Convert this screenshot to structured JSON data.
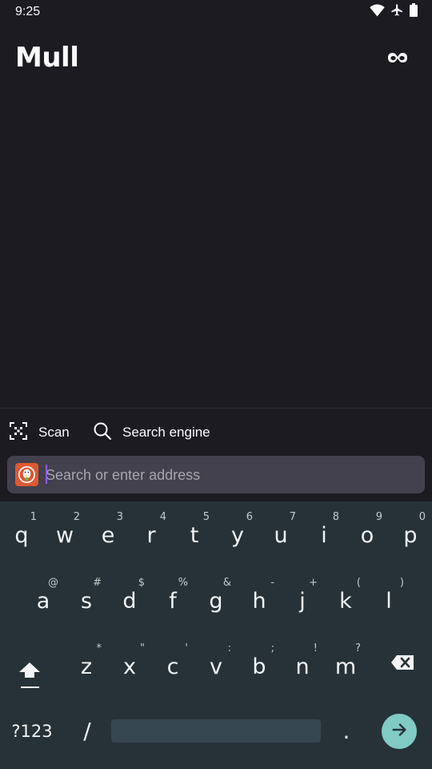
{
  "status_bar": {
    "time": "9:25",
    "icons": [
      "wifi-icon",
      "airplane-mode-icon",
      "battery-icon"
    ]
  },
  "header": {
    "app_title": "Mull",
    "private_mode_icon": "mask-icon"
  },
  "toolbar": {
    "scan_label": "Scan",
    "search_engine_label": "Search engine"
  },
  "url_bar": {
    "placeholder": "Search or enter address",
    "value": "",
    "engine_icon": "duckduckgo-icon"
  },
  "keyboard": {
    "row1": [
      {
        "key": "q",
        "hint": "1"
      },
      {
        "key": "w",
        "hint": "2"
      },
      {
        "key": "e",
        "hint": "3"
      },
      {
        "key": "r",
        "hint": "4"
      },
      {
        "key": "t",
        "hint": "5"
      },
      {
        "key": "y",
        "hint": "6"
      },
      {
        "key": "u",
        "hint": "7"
      },
      {
        "key": "i",
        "hint": "8"
      },
      {
        "key": "o",
        "hint": "9"
      },
      {
        "key": "p",
        "hint": "0"
      }
    ],
    "row2": [
      {
        "key": "a",
        "hint": "@"
      },
      {
        "key": "s",
        "hint": "#"
      },
      {
        "key": "d",
        "hint": "$"
      },
      {
        "key": "f",
        "hint": "%"
      },
      {
        "key": "g",
        "hint": "&"
      },
      {
        "key": "h",
        "hint": "-"
      },
      {
        "key": "j",
        "hint": "+"
      },
      {
        "key": "k",
        "hint": "("
      },
      {
        "key": "l",
        "hint": ")"
      }
    ],
    "row3": [
      {
        "key": "z",
        "hint": "*"
      },
      {
        "key": "x",
        "hint": "\""
      },
      {
        "key": "c",
        "hint": "'"
      },
      {
        "key": "v",
        "hint": ":"
      },
      {
        "key": "b",
        "hint": ";"
      },
      {
        "key": "n",
        "hint": "!"
      },
      {
        "key": "m",
        "hint": "?"
      }
    ],
    "symbols_label": "?123",
    "slash_label": "/",
    "period_label": ".",
    "accent_color": "#80cbc4"
  }
}
